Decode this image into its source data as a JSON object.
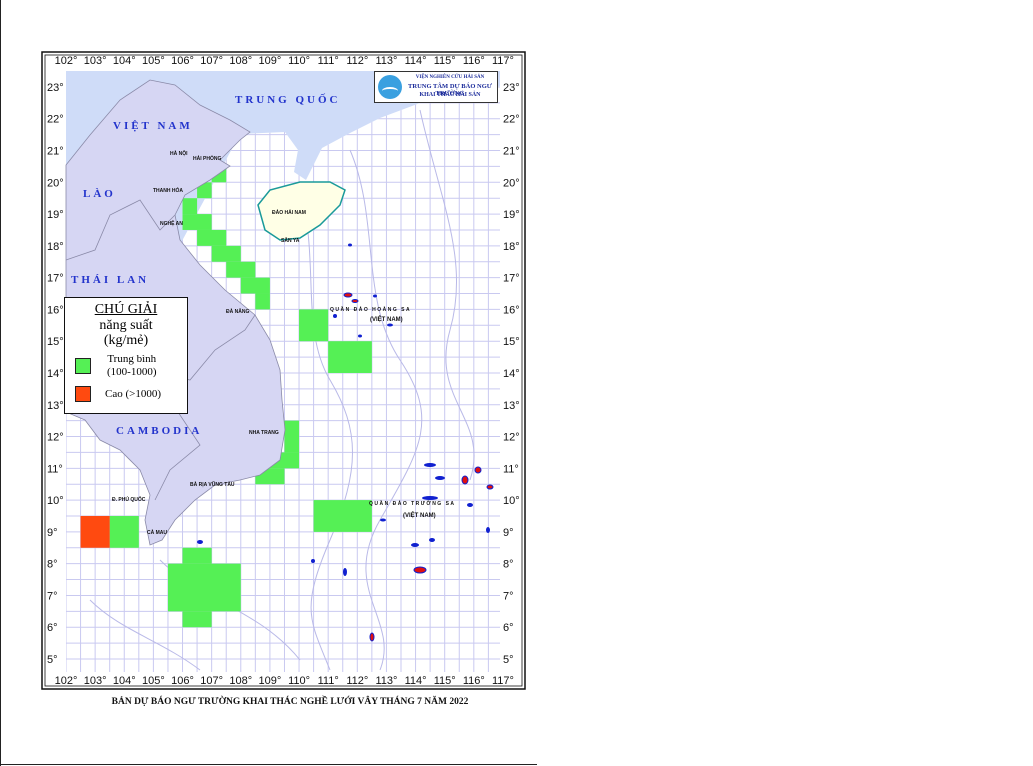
{
  "map": {
    "lon_ticks": [
      "102°",
      "103°",
      "104°",
      "105°",
      "106°",
      "107°",
      "108°",
      "109°",
      "110°",
      "111°",
      "112°",
      "113°",
      "114°",
      "115°",
      "116°",
      "117°"
    ],
    "lat_ticks": [
      "23°",
      "22°",
      "21°",
      "20°",
      "19°",
      "18°",
      "17°",
      "16°",
      "15°",
      "14°",
      "13°",
      "12°",
      "11°",
      "10°",
      "9°",
      "8°",
      "7°",
      "6°",
      "5°"
    ],
    "lon_range": [
      102,
      117
    ],
    "lat_range": [
      5,
      23
    ],
    "grid_step_deg": 0.5,
    "colors": {
      "sea_outside": "#cfdcf8",
      "sea_grid": "#ffffff",
      "grid": "#c9c9f0",
      "land": "#d6d6f3",
      "hainan": "#ffffe6",
      "hainan_border": "#1a9a9a",
      "medium": "#55f055",
      "high": "#ff4a10"
    },
    "countries": {
      "china": "TRUNG QUỐC",
      "vietnam": "VIỆT NAM",
      "laos": "LÀO",
      "thailand": "THÁI LAN",
      "cambodia": "CAMBODIA"
    },
    "places": {
      "ha_noi": "HÀ NỘI",
      "hai_phong": "HẢI PHÒNG",
      "thanh_hoa": "THANH HÓA",
      "nghe_an": "NGHỆ AN",
      "da_nang": "ĐÀ NẴNG",
      "nha_trang": "NHA TRANG",
      "ba_ria_vung_tau": "BÀ RỊA VŨNG TÀU",
      "ca_mau": "CÀ MAU",
      "phu_quoc": "Đ. PHÚ QUỐC",
      "hainan": "ĐẢO HẢI NAM",
      "sanya": "SÂN YA"
    },
    "archipelagos": {
      "hoang_sa": "QUẦN ĐẢO HOÀNG SA",
      "hoang_sa_country": "(VIỆT NAM)",
      "truong_sa": "QUẦN ĐẢO TRƯỜNG SA",
      "truong_sa_country": "(VIỆT NAM)"
    },
    "forecast_cells": [
      {
        "level": "medium",
        "lon": [
          107,
          107.5
        ],
        "lat": [
          20,
          20.5
        ]
      },
      {
        "level": "medium",
        "lon": [
          106.5,
          107
        ],
        "lat": [
          19.5,
          20
        ]
      },
      {
        "level": "medium",
        "lon": [
          106,
          106.5
        ],
        "lat": [
          19,
          19.5
        ]
      },
      {
        "level": "medium",
        "lon": [
          106,
          107
        ],
        "lat": [
          18.5,
          19
        ]
      },
      {
        "level": "medium",
        "lon": [
          106.5,
          107.5
        ],
        "lat": [
          18,
          18.5
        ]
      },
      {
        "level": "medium",
        "lon": [
          107,
          108
        ],
        "lat": [
          17.5,
          18
        ]
      },
      {
        "level": "medium",
        "lon": [
          107.5,
          108.5
        ],
        "lat": [
          17,
          17.5
        ]
      },
      {
        "level": "medium",
        "lon": [
          108,
          109
        ],
        "lat": [
          16.5,
          17
        ]
      },
      {
        "level": "medium",
        "lon": [
          108.5,
          109
        ],
        "lat": [
          16,
          16.5
        ]
      },
      {
        "level": "medium",
        "lon": [
          110,
          111
        ],
        "lat": [
          15,
          16
        ]
      },
      {
        "level": "medium",
        "lon": [
          111,
          112.5
        ],
        "lat": [
          14,
          15
        ]
      },
      {
        "level": "medium",
        "lon": [
          109.5,
          110
        ],
        "lat": [
          11.5,
          12.5
        ]
      },
      {
        "level": "medium",
        "lon": [
          109,
          110
        ],
        "lat": [
          11,
          11.5
        ]
      },
      {
        "level": "medium",
        "lon": [
          108.5,
          109.5
        ],
        "lat": [
          10.5,
          11
        ]
      },
      {
        "level": "medium",
        "lon": [
          110.5,
          112.5
        ],
        "lat": [
          9,
          10
        ]
      },
      {
        "level": "medium",
        "lon": [
          103.5,
          104.5
        ],
        "lat": [
          8.5,
          9.5
        ]
      },
      {
        "level": "high",
        "lon": [
          102.5,
          103.5
        ],
        "lat": [
          8.5,
          9.5
        ]
      },
      {
        "level": "medium",
        "lon": [
          106,
          107
        ],
        "lat": [
          8,
          8.5
        ]
      },
      {
        "level": "medium",
        "lon": [
          105.5,
          108
        ],
        "lat": [
          6.5,
          8
        ]
      },
      {
        "level": "medium",
        "lon": [
          106,
          107
        ],
        "lat": [
          6,
          6.5
        ]
      }
    ]
  },
  "legend": {
    "title": "CHÚ GIẢI",
    "subtitle_1": "năng suất",
    "subtitle_2": "(kg/mẻ)",
    "items": [
      {
        "label_1": "Trung bình",
        "label_2": "(100-1000)",
        "color": "#55f055"
      },
      {
        "label_1": "Cao (>1000)",
        "color": "#ff4a10"
      }
    ]
  },
  "logo": {
    "line_1": "VIỆN NGHIÊN CỨU HẢI SẢN",
    "line_2": "TRUNG TÂM DỰ BÁO NGƯ TRƯỜNG",
    "line_3": "KHAI THÁC HẢI SẢN"
  },
  "caption": "BẢN DỰ BÁO NGƯ TRƯỜNG KHAI THÁC NGHỀ LƯỚI VÂY THÁNG 7 NĂM 2022"
}
